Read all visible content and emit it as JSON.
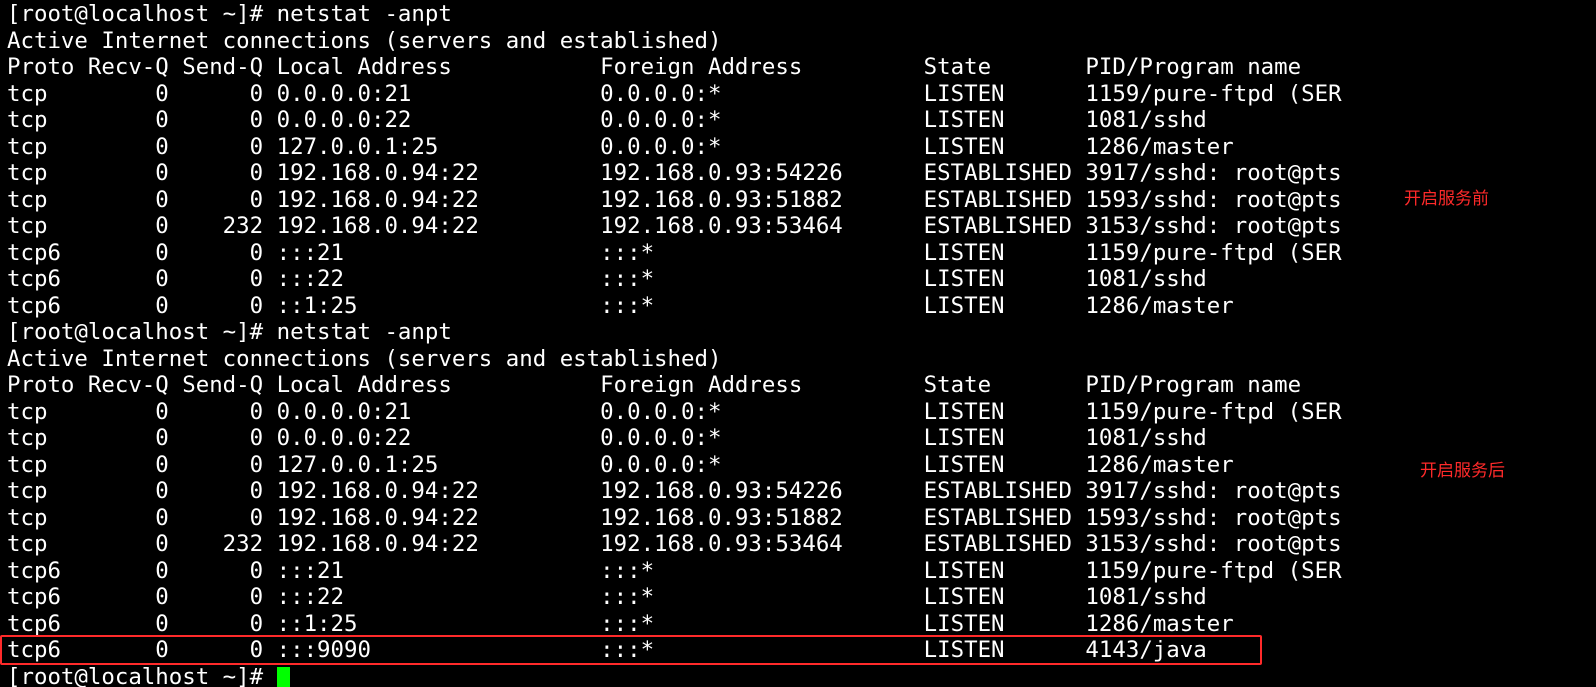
{
  "terminal": {
    "lines": [
      "[root@localhost ~]# netstat -anpt",
      "Active Internet connections (servers and established)",
      "Proto Recv-Q Send-Q Local Address           Foreign Address         State       PID/Program name",
      "tcp        0      0 0.0.0.0:21              0.0.0.0:*               LISTEN      1159/pure-ftpd (SER",
      "tcp        0      0 0.0.0.0:22              0.0.0.0:*               LISTEN      1081/sshd",
      "tcp        0      0 127.0.0.1:25            0.0.0.0:*               LISTEN      1286/master",
      "tcp        0      0 192.168.0.94:22         192.168.0.93:54226      ESTABLISHED 3917/sshd: root@pts",
      "tcp        0      0 192.168.0.94:22         192.168.0.93:51882      ESTABLISHED 1593/sshd: root@pts",
      "tcp        0    232 192.168.0.94:22         192.168.0.93:53464      ESTABLISHED 3153/sshd: root@pts",
      "tcp6       0      0 :::21                   :::*                    LISTEN      1159/pure-ftpd (SER",
      "tcp6       0      0 :::22                   :::*                    LISTEN      1081/sshd",
      "tcp6       0      0 ::1:25                  :::*                    LISTEN      1286/master",
      "[root@localhost ~]# netstat -anpt",
      "Active Internet connections (servers and established)",
      "Proto Recv-Q Send-Q Local Address           Foreign Address         State       PID/Program name",
      "tcp        0      0 0.0.0.0:21              0.0.0.0:*               LISTEN      1159/pure-ftpd (SER",
      "tcp        0      0 0.0.0.0:22              0.0.0.0:*               LISTEN      1081/sshd",
      "tcp        0      0 127.0.0.1:25            0.0.0.0:*               LISTEN      1286/master",
      "tcp        0      0 192.168.0.94:22         192.168.0.93:54226      ESTABLISHED 3917/sshd: root@pts",
      "tcp        0      0 192.168.0.94:22         192.168.0.93:51882      ESTABLISHED 1593/sshd: root@pts",
      "tcp        0    232 192.168.0.94:22         192.168.0.93:53464      ESTABLISHED 3153/sshd: root@pts",
      "tcp6       0      0 :::21                   :::*                    LISTEN      1159/pure-ftpd (SER",
      "tcp6       0      0 :::22                   :::*                    LISTEN      1081/sshd",
      "tcp6       0      0 ::1:25                  :::*                    LISTEN      1286/master",
      "tcp6       0      0 :::9090                 :::*                    LISTEN      4143/java"
    ],
    "prompt": "[root@localhost ~]# ",
    "cursor_color": "#00ff00",
    "text_color": "#ffffff",
    "background_color": "#000000"
  },
  "annotations": {
    "before_label": "开启服务前",
    "after_label": "开启服务后",
    "color": "#ff2a2a"
  }
}
